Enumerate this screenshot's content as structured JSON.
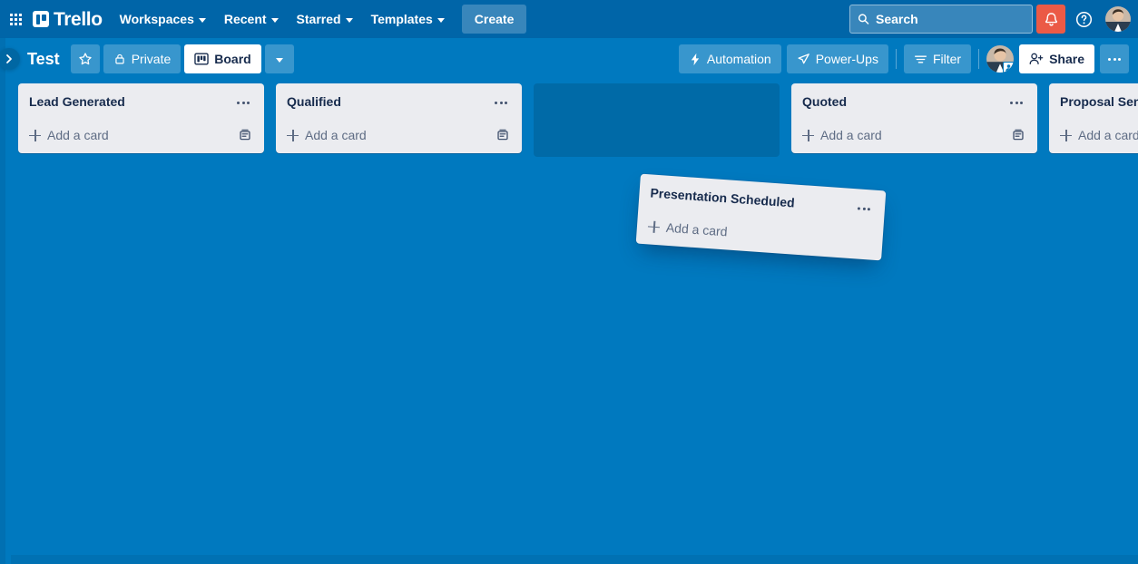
{
  "topnav": {
    "app_switcher_icon": "grid-apps-icon",
    "logo_icon": "trello-board-icon",
    "logo_text": "Trello",
    "items": [
      {
        "label": "Workspaces",
        "icon": "chevron-down-icon"
      },
      {
        "label": "Recent",
        "icon": "chevron-down-icon"
      },
      {
        "label": "Starred",
        "icon": "chevron-down-icon"
      },
      {
        "label": "Templates",
        "icon": "chevron-down-icon"
      }
    ],
    "create_label": "Create",
    "search": {
      "placeholder": "Search",
      "value": "",
      "icon": "search-icon"
    },
    "notifications_icon": "bell-icon",
    "notifications_color": "#eb5a46",
    "help_icon": "help-circle-icon",
    "avatar_icon": "user-avatar"
  },
  "boardbar": {
    "title": "Test",
    "star_icon": "star-outline-icon",
    "visibility_label": "Private",
    "visibility_icon": "lock-icon",
    "view_label": "Board",
    "view_icon": "board-view-icon",
    "view_dropdown_icon": "chevron-down-icon",
    "automation_label": "Automation",
    "automation_icon": "lightning-bolt-icon",
    "powerups_label": "Power-Ups",
    "powerups_icon": "rocket-icon",
    "filter_label": "Filter",
    "filter_icon": "filter-icon",
    "member_avatar_icon": "member-avatar",
    "share_label": "Share",
    "share_icon": "person-add-icon",
    "more_icon": "ellipsis-icon"
  },
  "sidebar": {
    "toggle_icon": "chevron-right-icon"
  },
  "board": {
    "add_card_label": "Add a card",
    "add_card_icon": "plus-icon",
    "card_template_icon": "card-template-icon",
    "list_menu_icon": "ellipsis-icon",
    "lists": [
      {
        "title": "Lead Generated"
      },
      {
        "title": "Qualified"
      },
      {
        "title": "Quoted"
      },
      {
        "title": "Proposal Sent"
      }
    ],
    "dragged_list": {
      "title": "Presentation Scheduled",
      "state": "dragging"
    },
    "drop_placeholder": {
      "label": "",
      "position_index": 2
    }
  },
  "colors": {
    "board_background": "#0079bf",
    "topnav_background": "#0065a8",
    "list_background": "#ebecf0",
    "accent_notification": "#eb5a46",
    "text_dark": "#172b4d",
    "text_muted": "#5e6c84"
  }
}
